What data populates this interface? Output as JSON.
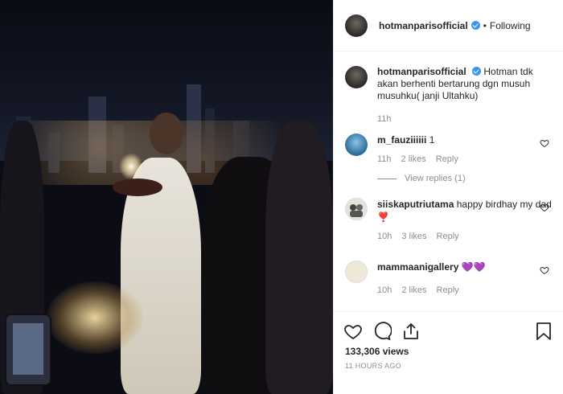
{
  "post": {
    "username": "hotmanparisofficial",
    "follow_separator": "•",
    "follow_label": "Following",
    "caption": "Hotman tdk akan berhenti bertarung dgn musuh musuhku( janji Ultahku)",
    "caption_time": "11h"
  },
  "comments": [
    {
      "username": "m_fauziiiiii",
      "text": "1",
      "time": "11h",
      "likes": "2 likes",
      "reply": "Reply",
      "view_replies": "View replies (1)"
    },
    {
      "username": "siiskaputriutama",
      "text": "happy birdhay my dad ❣️",
      "time": "10h",
      "likes": "3 likes",
      "reply": "Reply"
    },
    {
      "username": "mammaanigallery",
      "text": "💜💜",
      "time": "10h",
      "likes": "2 likes",
      "reply": "Reply"
    }
  ],
  "footer": {
    "views": "133,306 views",
    "posted": "11 HOURS AGO"
  },
  "icons": {
    "like": "heart-icon",
    "comment": "comment-icon",
    "share": "share-icon",
    "save": "bookmark-icon",
    "verified": "verified-badge-icon"
  },
  "colors": {
    "verified": "#3897f0",
    "secondary_text": "#8e8e8e",
    "heart_red": "#ed4956",
    "purple_heart": "#8a63d2"
  }
}
